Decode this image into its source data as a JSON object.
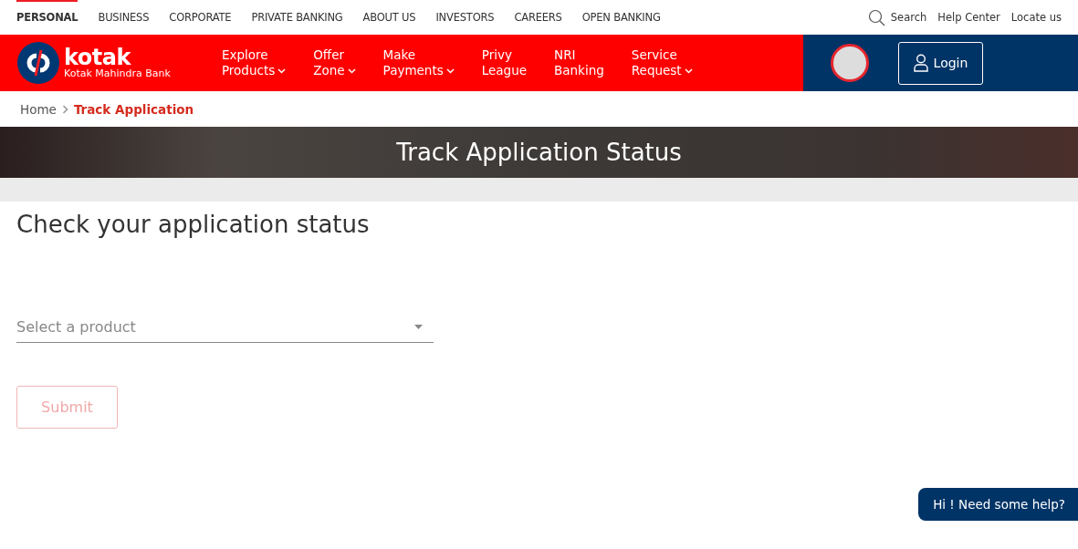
{
  "top_nav": [
    {
      "label": "PERSONAL",
      "selected": true
    },
    {
      "label": "BUSINESS",
      "selected": false
    },
    {
      "label": "CORPORATE",
      "selected": false
    },
    {
      "label": "PRIVATE BANKING",
      "selected": false
    },
    {
      "label": "ABOUT US",
      "selected": false
    },
    {
      "label": "INVESTORS",
      "selected": false
    },
    {
      "label": "CAREERS",
      "selected": false
    },
    {
      "label": "OPEN BANKING",
      "selected": false
    }
  ],
  "utility_links": {
    "search": "Search",
    "links": [
      "Help Center",
      "Locate us"
    ]
  },
  "logo": {
    "name": "kotak",
    "tagline": "Kotak Mahindra Bank"
  },
  "main_nav": [
    {
      "lines": [
        "Explore",
        "Products"
      ],
      "dropdown": true
    },
    {
      "lines": [
        "Offer",
        "Zone"
      ],
      "dropdown": true
    },
    {
      "lines": [
        "Make",
        "Payments"
      ],
      "dropdown": true
    },
    {
      "lines": [
        "Privy",
        "League"
      ],
      "dropdown": false
    },
    {
      "lines": [
        "NRI",
        "Banking"
      ],
      "dropdown": false
    },
    {
      "lines": [
        "Service",
        "Request"
      ],
      "dropdown": true
    }
  ],
  "login_button": "Login",
  "breadcrumb": [
    "Home",
    "Track Application"
  ],
  "banner_title": "Track Application Status",
  "form": {
    "heading": "Check your application status",
    "product_select": {
      "placeholder": "Select a product"
    },
    "submit": {
      "label": "Submit",
      "disabled": true
    }
  },
  "chat_button": "Hi ! Need some help?"
}
